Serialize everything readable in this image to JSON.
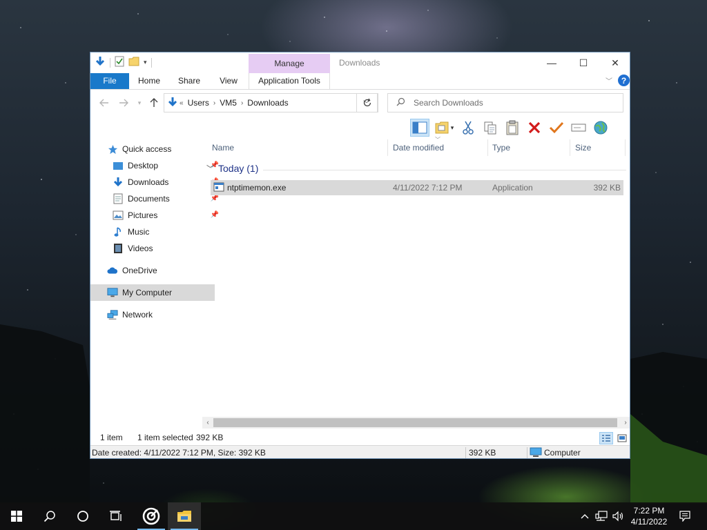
{
  "window": {
    "title": "Downloads",
    "context_tab": "Manage",
    "controls": {
      "minimize": "—",
      "maximize": "☐",
      "close": "✕"
    }
  },
  "ribbon": {
    "tabs": [
      {
        "label": "File"
      },
      {
        "label": "Home"
      },
      {
        "label": "Share"
      },
      {
        "label": "View"
      },
      {
        "label": "Application Tools"
      }
    ],
    "help": "?"
  },
  "navigation": {
    "breadcrumb_prefix": "«",
    "breadcrumb": [
      "Users",
      "VM5",
      "Downloads"
    ],
    "search_placeholder": "Search Downloads"
  },
  "toolbar": {
    "icons": [
      "preview-pane-icon",
      "properties-icon",
      "cut-icon",
      "copy-icon",
      "paste-icon",
      "delete-icon",
      "checkmark-icon",
      "rename-icon",
      "globe-icon"
    ]
  },
  "sidebar": {
    "items": [
      {
        "label": "Quick access",
        "icon": "star-icon",
        "pinned": false
      },
      {
        "label": "Desktop",
        "icon": "desktop-folder-icon",
        "pinned": true
      },
      {
        "label": "Downloads",
        "icon": "download-arrow-icon",
        "pinned": true
      },
      {
        "label": "Documents",
        "icon": "documents-icon",
        "pinned": true
      },
      {
        "label": "Pictures",
        "icon": "pictures-icon",
        "pinned": true
      },
      {
        "label": "Music",
        "icon": "music-icon",
        "pinned": false
      },
      {
        "label": "Videos",
        "icon": "videos-icon",
        "pinned": false
      },
      {
        "label": "OneDrive",
        "icon": "cloud-icon",
        "pinned": false
      },
      {
        "label": "My Computer",
        "icon": "computer-icon",
        "pinned": false,
        "selected": true
      },
      {
        "label": "Network",
        "icon": "network-icon",
        "pinned": false
      }
    ]
  },
  "file_list": {
    "columns": [
      "Name",
      "Date modified",
      "Type",
      "Size"
    ],
    "group": "Today (1)",
    "rows": [
      {
        "name": "ntptimemon.exe",
        "date_modified": "4/11/2022 7:12 PM",
        "type": "Application",
        "size": "392 KB",
        "selected": true
      }
    ]
  },
  "item_bar": {
    "count": "1 item",
    "selection": "1 item selected",
    "selection_size": "392 KB"
  },
  "status_bar": {
    "details": "Date created: 4/11/2022 7:12 PM, Size: 392 KB",
    "size": "392 KB",
    "location": "Computer"
  },
  "taskbar": {
    "time": "7:22 PM",
    "date": "4/11/2022",
    "icons": [
      "windows-start-icon",
      "search-icon",
      "cortana-icon",
      "task-view-icon",
      "app-target-icon",
      "file-explorer-icon"
    ],
    "tray_icons": [
      "chevron-up-icon",
      "network-tray-icon",
      "volume-icon",
      "notifications-icon"
    ]
  },
  "colors": {
    "accent": "#1979ca",
    "selection": "#d9d9d9",
    "manage_tab": "#e6ccf3",
    "group_header": "#1e3287"
  }
}
